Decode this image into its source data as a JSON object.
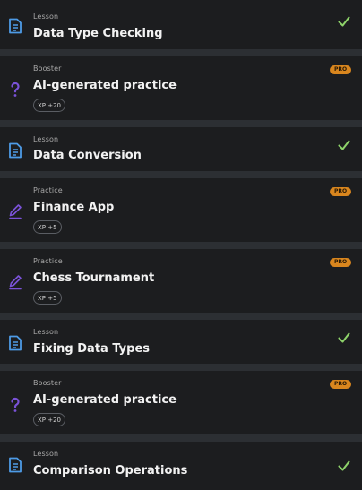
{
  "colors": {
    "lesson_icon": "#4e9be6",
    "booster_icon": "#7a52d8",
    "practice_icon": "#7a52d8",
    "check": "#8ed36a",
    "pro_badge": "#d9861e"
  },
  "items": [
    {
      "kind": "Lesson",
      "title": "Data Type Checking",
      "icon": "document-icon",
      "completed": true
    },
    {
      "kind": "Booster",
      "title": "AI-generated practice",
      "icon": "question-icon",
      "pro": "PRO",
      "xp": "XP +20"
    },
    {
      "kind": "Lesson",
      "title": "Data Conversion",
      "icon": "document-icon",
      "completed": true
    },
    {
      "kind": "Practice",
      "title": "Finance App",
      "icon": "pencil-icon",
      "pro": "PRO",
      "xp": "XP +5"
    },
    {
      "kind": "Practice",
      "title": "Chess Tournament",
      "icon": "pencil-icon",
      "pro": "PRO",
      "xp": "XP +5"
    },
    {
      "kind": "Lesson",
      "title": "Fixing Data Types",
      "icon": "document-icon",
      "completed": true
    },
    {
      "kind": "Booster",
      "title": "AI-generated practice",
      "icon": "question-icon",
      "pro": "PRO",
      "xp": "XP +20"
    },
    {
      "kind": "Lesson",
      "title": "Comparison Operations",
      "icon": "document-icon",
      "completed": true
    }
  ]
}
